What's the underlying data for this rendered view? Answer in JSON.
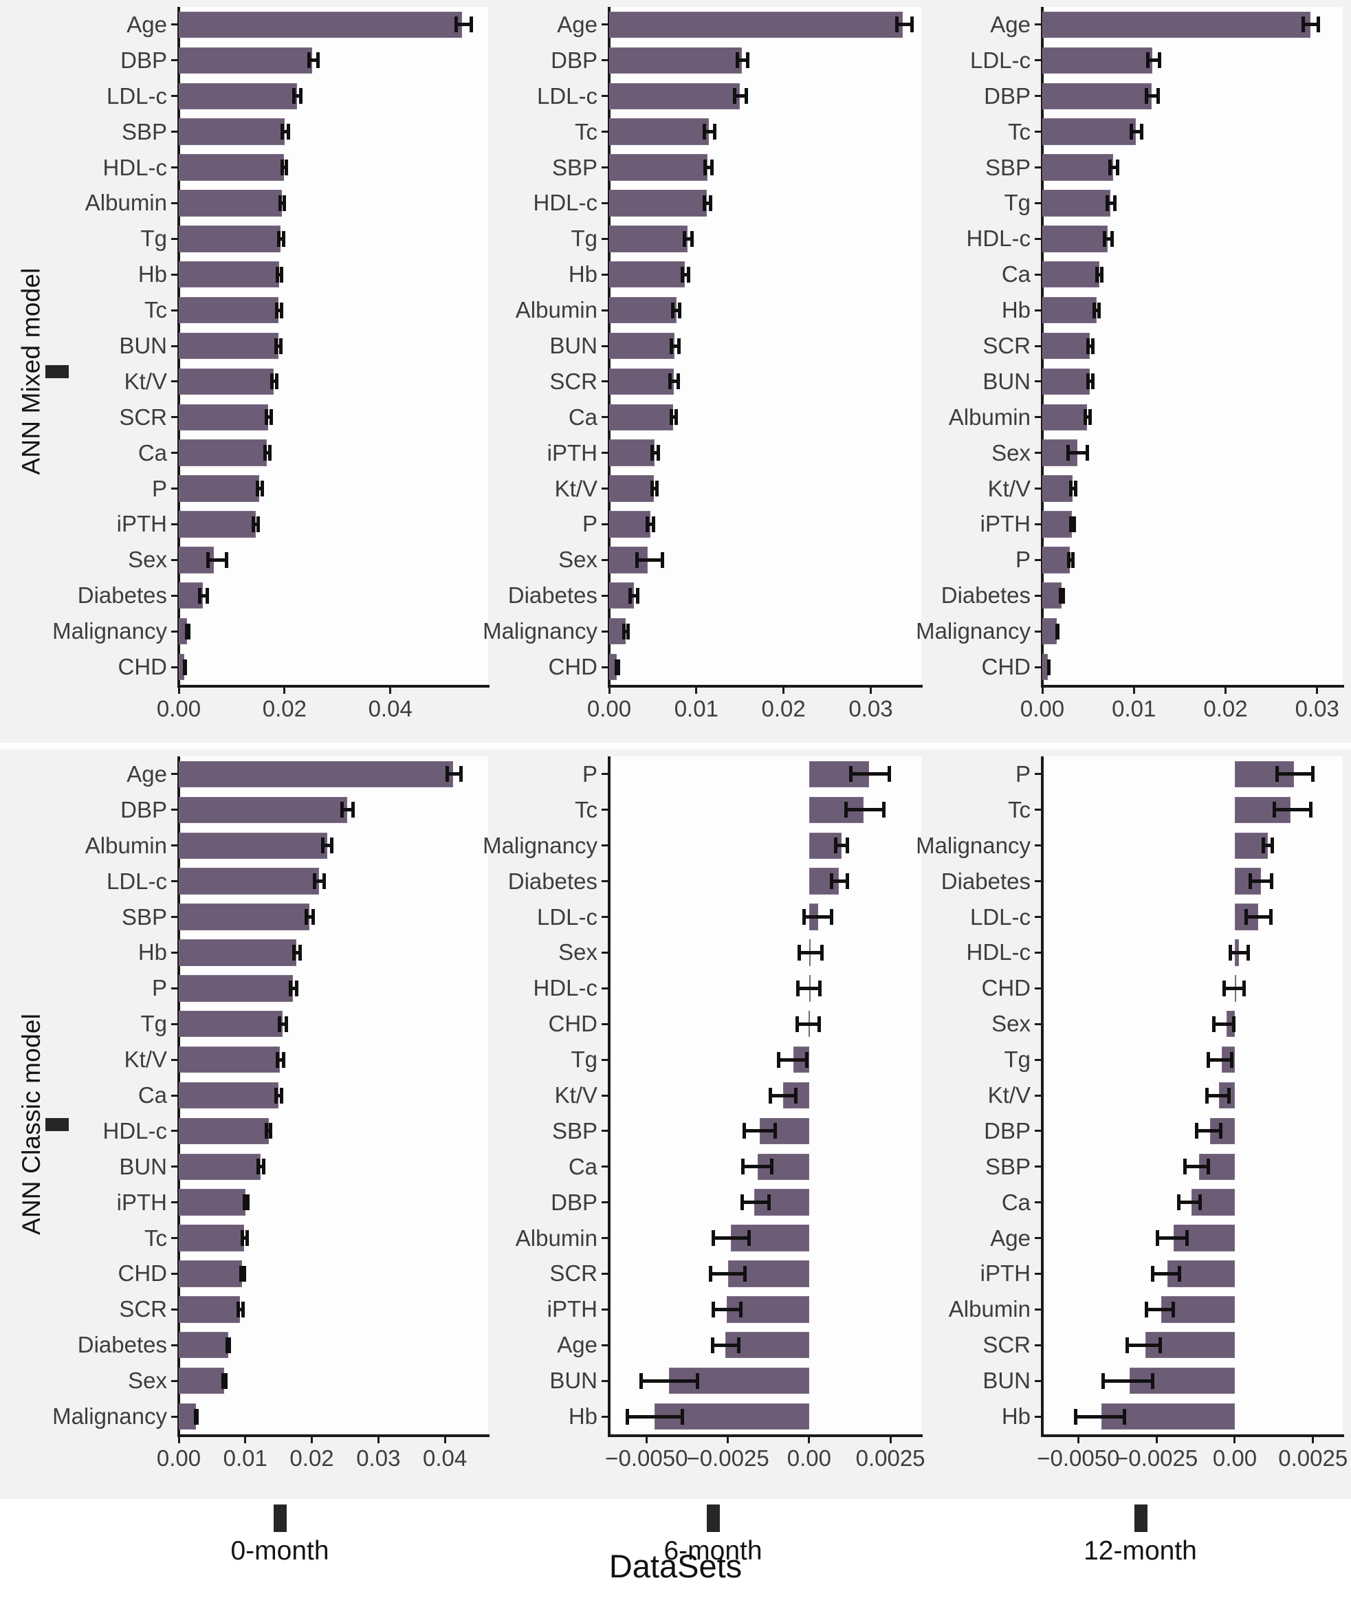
{
  "figure": {
    "axis_title": "DataSets",
    "row_labels": [
      "ANN Mixed model",
      "ANN Classic model"
    ],
    "dataset_labels": [
      "0-month",
      "6-month",
      "12-month"
    ],
    "bar_color": "#6d5c76",
    "error_color": "#101010",
    "panel_bg": "#fdfdfd",
    "strip_bg": "#f2f2f2"
  },
  "chart_data": [
    {
      "type": "bar",
      "orientation": "horizontal",
      "title": "ANN Mixed model - 0-month",
      "row": "ANN Mixed model",
      "dataset": "0-month",
      "xlabel": "",
      "ylabel": "",
      "xlim": [
        0,
        0.0585
      ],
      "xticks": [
        0.0,
        0.02,
        0.04
      ],
      "xticklabels": [
        "0.00",
        "0.02",
        "0.04"
      ],
      "grid": false,
      "categories": [
        "Age",
        "DBP",
        "LDL-c",
        "SBP",
        "HDL-c",
        "Albumin",
        "Tg",
        "Hb",
        "Tc",
        "BUN",
        "Kt/V",
        "SCR",
        "Ca",
        "P",
        "iPTH",
        "Sex",
        "Diabetes",
        "Malignancy",
        "CHD"
      ],
      "values": [
        0.0535,
        0.0252,
        0.0224,
        0.02,
        0.0199,
        0.0195,
        0.0193,
        0.019,
        0.0189,
        0.0188,
        0.018,
        0.0169,
        0.0167,
        0.0152,
        0.0145,
        0.0066,
        0.0045,
        0.0016,
        0.0011
      ],
      "err_low": [
        0.0521,
        0.0243,
        0.0215,
        0.0192,
        0.0192,
        0.0188,
        0.0186,
        0.0183,
        0.0182,
        0.0181,
        0.0173,
        0.0162,
        0.016,
        0.0145,
        0.0138,
        0.0052,
        0.0037,
        0.0012,
        0.0008
      ],
      "err_high": [
        0.0556,
        0.0266,
        0.0234,
        0.021,
        0.0207,
        0.0203,
        0.0201,
        0.0198,
        0.0197,
        0.0196,
        0.0188,
        0.0178,
        0.0175,
        0.0161,
        0.0153,
        0.0094,
        0.0057,
        0.0022,
        0.0016
      ]
    },
    {
      "type": "bar",
      "orientation": "horizontal",
      "title": "ANN Mixed model - 6-month",
      "row": "ANN Mixed model",
      "dataset": "6-month",
      "xlabel": "",
      "ylabel": "",
      "xlim": [
        0,
        0.0358
      ],
      "xticks": [
        0.0,
        0.01,
        0.02,
        0.03
      ],
      "xticklabels": [
        "0.00",
        "0.01",
        "0.02",
        "0.03"
      ],
      "grid": false,
      "categories": [
        "Age",
        "DBP",
        "LDL-c",
        "Tc",
        "SBP",
        "HDL-c",
        "Tg",
        "Hb",
        "Albumin",
        "BUN",
        "SCR",
        "Ca",
        "iPTH",
        "Kt/V",
        "P",
        "Sex",
        "Diabetes",
        "Malignancy",
        "CHD"
      ],
      "values": [
        0.0337,
        0.0152,
        0.015,
        0.0114,
        0.0113,
        0.0112,
        0.009,
        0.0087,
        0.0077,
        0.0075,
        0.0074,
        0.0073,
        0.0052,
        0.0051,
        0.0047,
        0.0044,
        0.0028,
        0.0019,
        0.0009
      ],
      "err_low": [
        0.0328,
        0.0145,
        0.0142,
        0.0107,
        0.0108,
        0.0107,
        0.0084,
        0.0082,
        0.0071,
        0.0069,
        0.0068,
        0.0069,
        0.0047,
        0.0047,
        0.0042,
        0.003,
        0.0022,
        0.0015,
        0.0006
      ],
      "err_high": [
        0.0349,
        0.0161,
        0.0159,
        0.0123,
        0.012,
        0.0118,
        0.0097,
        0.0093,
        0.0083,
        0.0082,
        0.0081,
        0.0079,
        0.0058,
        0.0057,
        0.0053,
        0.0063,
        0.0035,
        0.0024,
        0.0013
      ]
    },
    {
      "type": "bar",
      "orientation": "horizontal",
      "title": "ANN Mixed model - 12-month",
      "row": "ANN Mixed model",
      "dataset": "12-month",
      "xlabel": "",
      "ylabel": "",
      "xlim": [
        0,
        0.0328
      ],
      "xticks": [
        0.0,
        0.01,
        0.02,
        0.03
      ],
      "xticklabels": [
        "0.00",
        "0.01",
        "0.02",
        "0.03"
      ],
      "grid": false,
      "categories": [
        "Age",
        "LDL-c",
        "DBP",
        "Tc",
        "SBP",
        "Tg",
        "HDL-c",
        "Ca",
        "Hb",
        "SCR",
        "BUN",
        "Albumin",
        "Sex",
        "Kt/V",
        "iPTH",
        "P",
        "Diabetes",
        "Malignancy",
        "CHD"
      ],
      "values": [
        0.0293,
        0.012,
        0.0119,
        0.0102,
        0.0077,
        0.0074,
        0.0071,
        0.0062,
        0.0059,
        0.0052,
        0.0052,
        0.0049,
        0.0038,
        0.0033,
        0.0032,
        0.003,
        0.0021,
        0.0016,
        0.0006
      ],
      "err_low": [
        0.0283,
        0.0113,
        0.0112,
        0.0095,
        0.0072,
        0.0069,
        0.0066,
        0.0058,
        0.0055,
        0.0048,
        0.0048,
        0.0045,
        0.0026,
        0.0029,
        0.0029,
        0.0027,
        0.0018,
        0.0014,
        0.0005
      ],
      "err_high": [
        0.0303,
        0.013,
        0.0128,
        0.011,
        0.0084,
        0.0081,
        0.0078,
        0.0067,
        0.0064,
        0.0057,
        0.0057,
        0.0054,
        0.0051,
        0.0038,
        0.0037,
        0.0035,
        0.0025,
        0.0019,
        0.0009
      ]
    },
    {
      "type": "bar",
      "orientation": "horizontal",
      "title": "ANN Classic model - 0-month",
      "row": "ANN Classic model",
      "dataset": "0-month",
      "xlabel": "",
      "ylabel": "",
      "xlim": [
        0,
        0.0465
      ],
      "xticks": [
        0.0,
        0.01,
        0.02,
        0.03,
        0.04
      ],
      "xticklabels": [
        "0.00",
        "0.01",
        "0.02",
        "0.03",
        "0.04"
      ],
      "grid": false,
      "categories": [
        "Age",
        "DBP",
        "Albumin",
        "LDL-c",
        "SBP",
        "Hb",
        "P",
        "Tg",
        "Kt/V",
        "Ca",
        "HDL-c",
        "BUN",
        "iPTH",
        "Tc",
        "CHD",
        "SCR",
        "Diabetes",
        "Sex",
        "Malignancy"
      ],
      "values": [
        0.0412,
        0.0253,
        0.0223,
        0.0211,
        0.0196,
        0.0177,
        0.0172,
        0.0156,
        0.0152,
        0.015,
        0.0135,
        0.0123,
        0.01,
        0.0098,
        0.0095,
        0.0092,
        0.0074,
        0.0068,
        0.0026
      ],
      "err_low": [
        0.0401,
        0.0243,
        0.0214,
        0.0202,
        0.0189,
        0.0171,
        0.0165,
        0.0149,
        0.0146,
        0.0144,
        0.0129,
        0.0117,
        0.0096,
        0.0093,
        0.0091,
        0.0087,
        0.007,
        0.0064,
        0.0023
      ],
      "err_high": [
        0.0427,
        0.0265,
        0.0233,
        0.0221,
        0.0205,
        0.0185,
        0.018,
        0.0164,
        0.016,
        0.0157,
        0.0141,
        0.013,
        0.0106,
        0.0105,
        0.0101,
        0.0099,
        0.0079,
        0.0073,
        0.003
      ]
    },
    {
      "type": "bar",
      "orientation": "horizontal",
      "title": "ANN Classic model - 6-month",
      "row": "ANN Classic model",
      "dataset": "6-month",
      "xlabel": "",
      "ylabel": "",
      "xlim": [
        -0.00615,
        0.00345
      ],
      "xticks": [
        -0.005,
        -0.0025,
        0.0,
        0.0025
      ],
      "xticklabels": [
        "−0.0050",
        "−0.0025",
        "0.00",
        "0.0025"
      ],
      "grid": false,
      "categories": [
        "P",
        "Tc",
        "Malignancy",
        "Diabetes",
        "LDL-c",
        "Sex",
        "HDL-c",
        "CHD",
        "Tg",
        "Kt/V",
        "SBP",
        "Ca",
        "DBP",
        "Albumin",
        "SCR",
        "iPTH",
        "Age",
        "BUN",
        "Hb"
      ],
      "values": [
        0.00185,
        0.00168,
        0.001,
        0.00092,
        0.00027,
        4e-05,
        0.0,
        -2e-05,
        -0.00048,
        -0.0008,
        -0.00152,
        -0.00159,
        -0.00168,
        -0.0024,
        -0.0025,
        -0.00253,
        -0.00258,
        -0.0043,
        -0.00475
      ],
      "err_low": [
        0.00123,
        0.00108,
        0.00077,
        0.00063,
        -0.0002,
        -0.00036,
        -0.0004,
        -0.00042,
        -0.00098,
        -0.00125,
        -0.00204,
        -0.00209,
        -0.00212,
        -0.003,
        -0.00308,
        -0.003,
        -0.00303,
        -0.00522,
        -0.00565
      ],
      "err_high": [
        0.00252,
        0.00235,
        0.00124,
        0.00124,
        0.00075,
        0.00044,
        0.00038,
        0.00036,
        -2e-05,
        -0.00035,
        -0.001,
        -0.0011,
        -0.00119,
        -0.0018,
        -0.00192,
        -0.00204,
        -0.00212,
        -0.00338,
        -0.00385
      ]
    },
    {
      "type": "bar",
      "orientation": "horizontal",
      "title": "ANN Classic model - 12-month",
      "row": "ANN Classic model",
      "dataset": "12-month",
      "xlabel": "",
      "ylabel": "",
      "xlim": [
        -0.00615,
        0.00345
      ],
      "xticks": [
        -0.005,
        -0.0025,
        0.0,
        0.0025
      ],
      "xticklabels": [
        "−0.0050",
        "−0.0025",
        "0.00",
        "0.0025"
      ],
      "grid": false,
      "categories": [
        "P",
        "Tc",
        "Malignancy",
        "Diabetes",
        "LDL-c",
        "HDL-c",
        "CHD",
        "Sex",
        "Tg",
        "Kt/V",
        "DBP",
        "SBP",
        "Ca",
        "Age",
        "iPTH",
        "Albumin",
        "SCR",
        "BUN",
        "Hb"
      ],
      "values": [
        0.0019,
        0.00178,
        0.00105,
        0.00083,
        0.00075,
        0.00013,
        0.0,
        -0.00027,
        -0.00042,
        -0.0005,
        -0.00078,
        -0.00115,
        -0.00138,
        -0.00195,
        -0.00215,
        -0.00235,
        -0.00285,
        -0.00335,
        -0.00425
      ],
      "err_low": [
        0.0013,
        0.00122,
        0.00085,
        0.00045,
        0.0003,
        -0.0002,
        -0.0004,
        -0.00073,
        -0.0009,
        -0.00095,
        -0.00128,
        -0.00165,
        -0.00185,
        -0.00252,
        -0.00268,
        -0.00288,
        -0.0035,
        -0.00427,
        -0.00515
      ],
      "err_high": [
        0.00255,
        0.00248,
        0.00125,
        0.00123,
        0.00122,
        0.00048,
        0.00035,
        3e-05,
        -5e-05,
        -0.00012,
        -0.0004,
        -0.0008,
        -0.00105,
        -0.00148,
        -0.00172,
        -0.0019,
        -0.00232,
        -0.00258,
        -0.00348
      ]
    }
  ]
}
